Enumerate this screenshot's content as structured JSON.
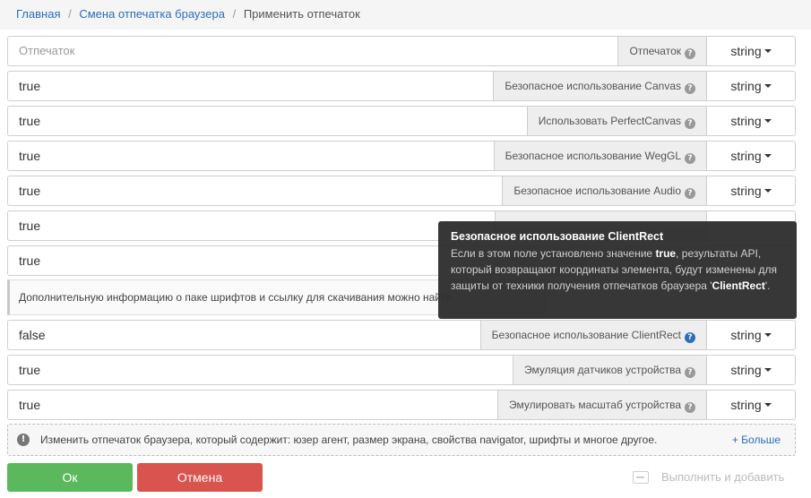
{
  "breadcrumb": {
    "home": "Главная",
    "parent": "Смена отпечатка браузера",
    "current": "Применить отпечаток",
    "separator": "/"
  },
  "rows": [
    {
      "value": "",
      "placeholder": "Отпечаток",
      "label": "Отпечаток",
      "type": "string"
    },
    {
      "value": "true",
      "label": "Безопасное использование Canvas",
      "type": "string"
    },
    {
      "value": "true",
      "label": "Использовать PerfectCanvas",
      "type": "string"
    },
    {
      "value": "true",
      "label": "Безопасное использование WegGL",
      "type": "string"
    },
    {
      "value": "true",
      "label": "Безопасное использование Audio",
      "type": "string"
    },
    {
      "value": "true",
      "label": "",
      "type": ""
    },
    {
      "value": "true",
      "label": "",
      "type": ""
    },
    {
      "value": "false",
      "label": "Безопасное использование ClientRect",
      "type": "string"
    },
    {
      "value": "true",
      "label": "Эмуляция датчиков устройства",
      "type": "string"
    },
    {
      "value": "true",
      "label": "Эмулировать масштаб устройства",
      "type": "string"
    }
  ],
  "info_text": "Дополнительную информацию о паке шрифтов и ссылку для скачивания можно найти",
  "tooltip": {
    "title": "Безопасное использование ClientRect",
    "text_1": "Если в этом поле установлено значение ",
    "bold_1": "true",
    "text_2": ", результаты API, который возвращают координаты элемента, будут изменены для защиты от техники получения отпечатков браузера '",
    "bold_2": "ClientRect",
    "text_3": "'."
  },
  "notice": {
    "text": "Изменить отпечаток браузера, который содержит: юзер агент, размер экрана, свойства navigator, шрифты и многое другое.",
    "more": "+ Больше"
  },
  "buttons": {
    "ok": "Ок",
    "cancel": "Отмена",
    "execute_add": "Выполнить и добавить"
  },
  "icons": {
    "help": "?",
    "notice": "!"
  },
  "colors": {
    "link": "#2a6ebb",
    "ok": "#5cb85c",
    "cancel": "#d9534f",
    "tooltip_bg": "#2f2f2f"
  }
}
